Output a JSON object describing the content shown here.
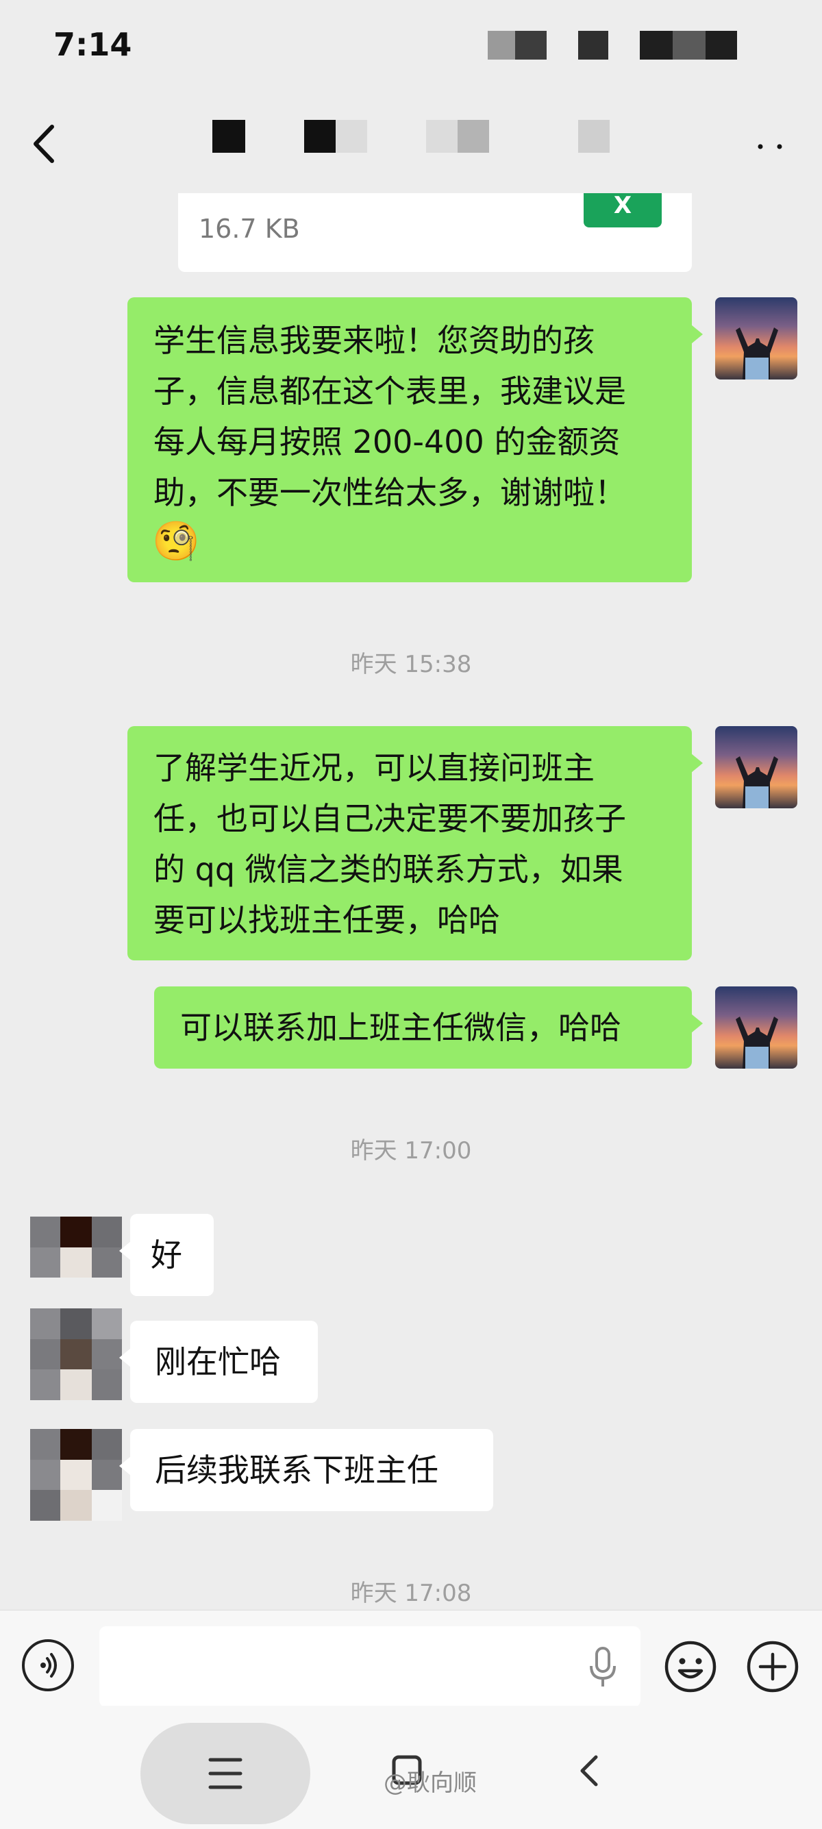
{
  "status_bar": {
    "time": "7:14"
  },
  "file_card": {
    "size": "16.7 KB",
    "file_icon": "excel-icon",
    "file_icon_glyph": "X"
  },
  "messages": [
    {
      "sender": "me",
      "text": "学生信息我要来啦！您资助的孩\n子，信息都在这个表里，我建议是\n每人每月按照 200-400 的金额资\n助，不要一次性给太多，谢谢啦！",
      "emoji": "🧐"
    },
    {
      "sender": "me",
      "text": "了解学生近况，可以直接问班主\n任，也可以自己决定要不要加孩子\n的 qq 微信之类的联系方式，如果\n要可以找班主任要，哈哈"
    },
    {
      "sender": "me",
      "text": "可以联系加上班主任微信，哈哈"
    },
    {
      "sender": "them",
      "text": "好"
    },
    {
      "sender": "them",
      "text": "刚在忙哈"
    },
    {
      "sender": "them",
      "text": "后续我联系下班主任"
    }
  ],
  "timestamps": [
    "昨天 15:38",
    "昨天 17:00",
    "昨天 17:08"
  ],
  "watermark": "@耿向顺",
  "colors": {
    "bubble_me": "#95ec69",
    "bubble_them": "#ffffff",
    "background": "#ededed"
  }
}
